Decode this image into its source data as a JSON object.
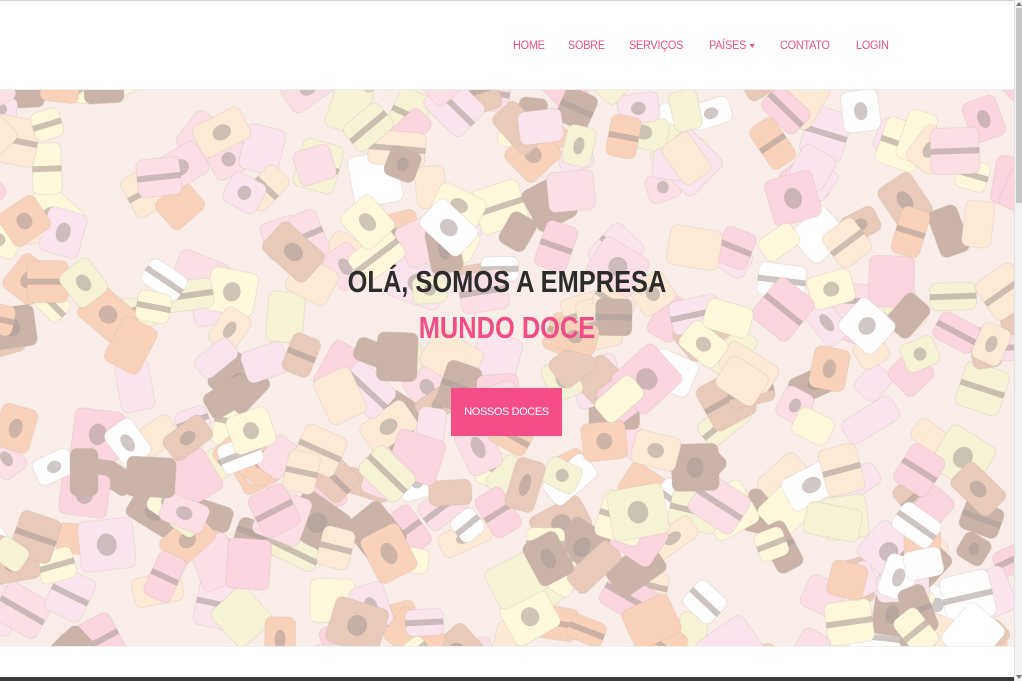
{
  "nav": {
    "items": [
      {
        "label": "HOME"
      },
      {
        "label": "SOBRE"
      },
      {
        "label": "SERVIÇOS"
      },
      {
        "label": "PAÍSES"
      },
      {
        "label": "CONTATO"
      },
      {
        "label": "LOGIN"
      }
    ]
  },
  "hero": {
    "title_line1": "OLÁ, SOMOS A EMPRESA",
    "title_line2": "MUNDO DOCE",
    "cta_label": "NOSSOS DOCES"
  },
  "colors": {
    "accent": "#ef4f86",
    "button": "#f44d88",
    "title": "#2c2c2c"
  },
  "icons": {
    "dropdown": "caret-down-icon"
  }
}
